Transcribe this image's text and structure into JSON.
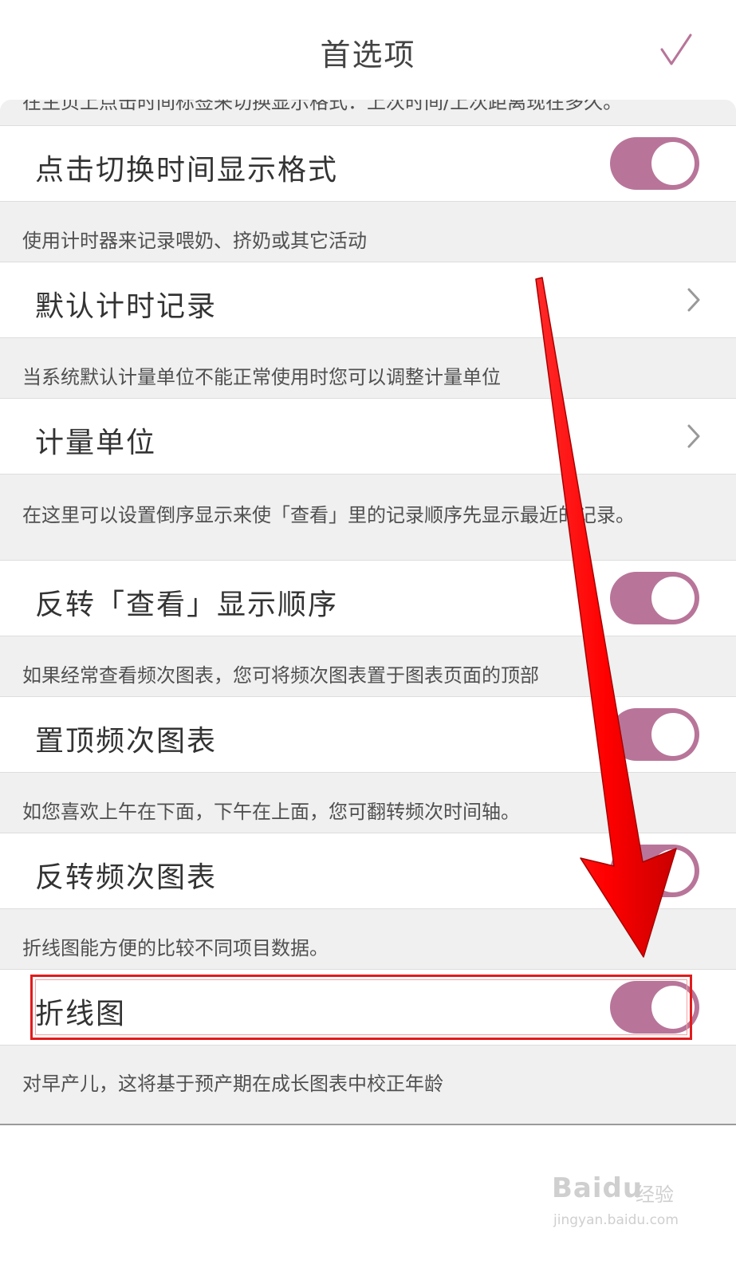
{
  "header": {
    "title": "首选项",
    "confirm_icon": "checkmark-icon"
  },
  "accent_color": "#b87599",
  "sections": [
    {
      "hint": "在主页上点击时间标签来切换显示格式：上次时间/上次距离现在多久。",
      "label": "点击切换时间显示格式",
      "control": "toggle",
      "on": true
    },
    {
      "hint": "使用计时器来记录喂奶、挤奶或其它活动",
      "label": "默认计时记录",
      "control": "chevron-right-icon"
    },
    {
      "hint": "当系统默认计量单位不能正常使用时您可以调整计量单位",
      "label": "计量单位",
      "control": "chevron-right-icon"
    },
    {
      "hint": "在这里可以设置倒序显示来使「查看」里的记录顺序先显示最近的记录。",
      "label": "反转「查看」显示顺序",
      "control": "toggle",
      "on": true
    },
    {
      "hint": "如果经常查看频次图表，您可将频次图表置于图表页面的顶部",
      "label": "置顶频次图表",
      "control": "toggle",
      "on": true
    },
    {
      "hint": "如您喜欢上午在下面，下午在上面，您可翻转频次时间轴。",
      "label": "反转频次图表",
      "control": "toggle",
      "on": true
    },
    {
      "hint": "折线图能方便的比较不同项目数据。",
      "label": "折线图",
      "control": "toggle",
      "on": true,
      "highlighted": true
    },
    {
      "hint": "对早产儿，这将基于预产期在成长图表中校正年龄"
    }
  ],
  "watermark": {
    "brand": "Baidu",
    "suffix": "经验",
    "url": "jingyan.baidu.com"
  }
}
